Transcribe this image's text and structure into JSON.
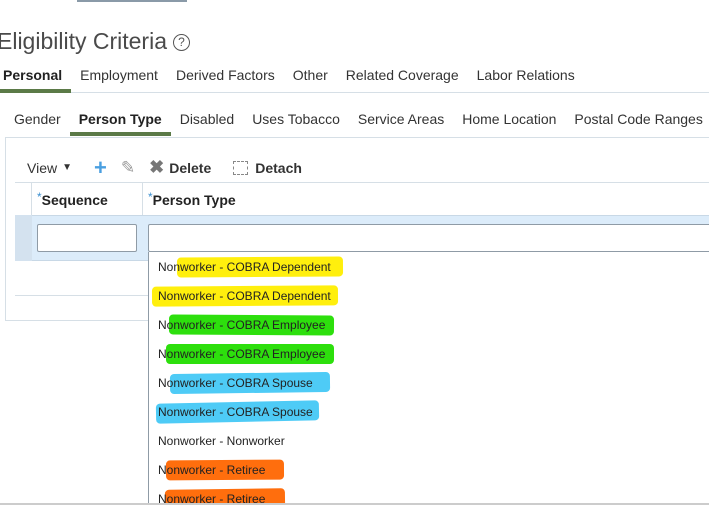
{
  "page_title": "Eligibility Criteria",
  "help_icon": "question-circle-icon",
  "main_tabs": [
    {
      "label": "Personal",
      "active": true
    },
    {
      "label": "Employment"
    },
    {
      "label": "Derived Factors"
    },
    {
      "label": "Other"
    },
    {
      "label": "Related Coverage"
    },
    {
      "label": "Labor Relations"
    }
  ],
  "sub_tabs": [
    {
      "label": "Gender"
    },
    {
      "label": "Person Type",
      "active": true
    },
    {
      "label": "Disabled"
    },
    {
      "label": "Uses Tobacco"
    },
    {
      "label": "Service Areas"
    },
    {
      "label": "Home Location"
    },
    {
      "label": "Postal Code Ranges"
    }
  ],
  "toolbar": {
    "view_label": "View",
    "delete_label": "Delete",
    "detach_label": "Detach"
  },
  "columns": {
    "required_mark": "*",
    "sequence": "Sequence",
    "person_type": "Person Type"
  },
  "row": {
    "sequence": "",
    "person_type": ""
  },
  "dropdown_items": [
    {
      "label": "Nonworker - COBRA Dependent",
      "highlight": "#ffee00"
    },
    {
      "label": "Nonworker - COBRA Dependent",
      "highlight": "#ffee00"
    },
    {
      "label": "Nonworker - COBRA Employee",
      "highlight": "#22dd00"
    },
    {
      "label": "Nonworker - COBRA Employee",
      "highlight": "#22dd00"
    },
    {
      "label": "Nonworker - COBRA Spouse",
      "highlight": "#44c8f5"
    },
    {
      "label": "Nonworker - COBRA Spouse",
      "highlight": "#44c8f5"
    },
    {
      "label": "Nonworker - Nonworker",
      "highlight": ""
    },
    {
      "label": "Nonworker - Retiree",
      "highlight": "#ff6600"
    },
    {
      "label": "Nonworker - Retiree",
      "highlight": "#ff6600"
    }
  ],
  "colors": {
    "accent_tab": "#5b7a47",
    "row_selected": "#dcecfa",
    "add_icon": "#4a9fe0"
  }
}
